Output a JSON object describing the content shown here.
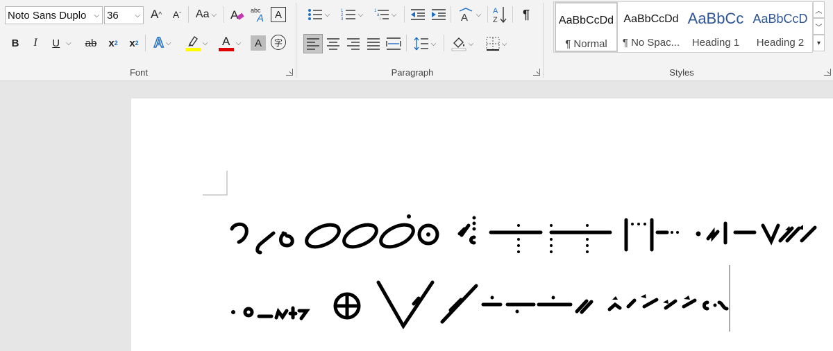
{
  "font_group": {
    "label": "Font",
    "font_name": "Noto Sans Duplo",
    "font_size": "36",
    "change_case_label": "Aa",
    "bold": "B",
    "italic": "I",
    "underline": "U",
    "strikethrough": "ab",
    "subscript": "x",
    "subscript_mark": "2",
    "superscript": "x",
    "superscript_mark": "2",
    "highlight_color": "#ffff00",
    "font_color": "#e00000",
    "char_shading": "A",
    "phonetic_glyph": "字",
    "enclose_glyph": "A",
    "spell_glyph": "abc"
  },
  "paragraph_group": {
    "label": "Paragraph",
    "sort_glyph_top": "A",
    "sort_glyph_bottom": "Z",
    "pilcrow": "¶"
  },
  "styles_group": {
    "label": "Styles",
    "items": [
      {
        "preview": "AaBbCcDd",
        "name": "¶ Normal",
        "selected": true
      },
      {
        "preview": "AaBbCcDd",
        "name": "¶ No Spac..."
      },
      {
        "preview": "AaBbCc",
        "name": "Heading 1"
      },
      {
        "preview": "AaBbCcD",
        "name": "Heading 2"
      }
    ]
  },
  "document": {
    "text_glyph_description": "Duployan shorthand glyphs (two lines)"
  },
  "colors": {
    "ribbon_bg": "#f3f3f3",
    "canvas_bg": "#e6e6e6",
    "heading_blue": "#2f5496"
  }
}
